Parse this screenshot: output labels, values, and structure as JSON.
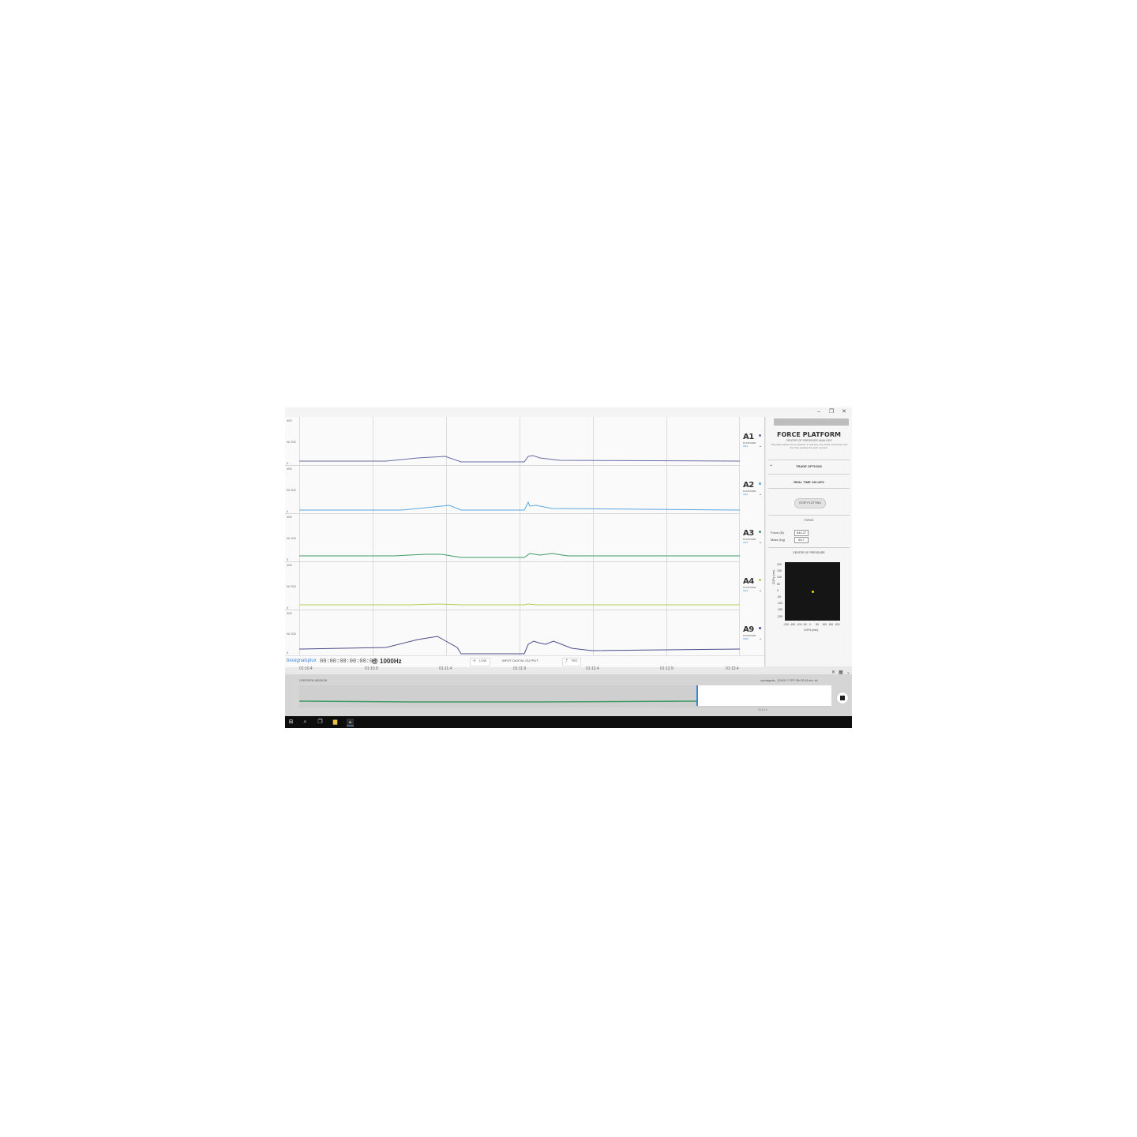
{
  "window": {
    "controls": [
      "–",
      "❐",
      "✕"
    ]
  },
  "channels": [
    {
      "name": "A1",
      "sublabel": "PLATFORM",
      "value": "CH1",
      "color": "#6a6aa8",
      "ylabels": [
        "400",
        "N/ 200",
        "0"
      ]
    },
    {
      "name": "A2",
      "sublabel": "PLATFORM",
      "value": "CH2",
      "color": "#5aa7e0",
      "ylabels": [
        "400",
        "N/ 200",
        "0"
      ]
    },
    {
      "name": "A3",
      "sublabel": "PLATFORM",
      "value": "CH3",
      "color": "#3f9a64",
      "ylabels": [
        "400",
        "N/ 200",
        "0"
      ]
    },
    {
      "name": "A4",
      "sublabel": "PLATFORM",
      "value": "CH4",
      "color": "#b3cf5a",
      "ylabels": [
        "400",
        "N/ 200",
        "0"
      ]
    },
    {
      "name": "A9",
      "sublabel": "PLATFORM",
      "value": "SUM",
      "color": "#4c4c8c",
      "ylabels": [
        "400",
        "N/ 200",
        "0"
      ]
    }
  ],
  "time_axis": [
    "01:10.4",
    "01:10.9",
    "01:11.4",
    "01:11.9",
    "01:12.4",
    "01:12.9",
    "01:13.4"
  ],
  "status": {
    "logo": "biosignalsplux",
    "clock": "00:00:00:00:00:00",
    "rate": "@ 1000Hz",
    "loop_label": "LOW",
    "digital_label": "INPUT   DIGITAL   OUTPUT",
    "trigger_label": "TRG"
  },
  "panel": {
    "title": "FORCE PLATFORM",
    "subtitle": "CENTER OF PRESSURE ANALYSIS",
    "description": "This plugin allows you to observe, in real time, the center of pressure and the force produced in each moment.",
    "trade_options": "TRADE OPTIONS",
    "real_time_values": "REAL TIME VALUES",
    "stop_button": "STOP PLOTTING",
    "force_section": "FORCE",
    "force_label": "Force (N)",
    "force_value": "644.27",
    "mass_label": "Mass (Kg)",
    "mass_value": "65.7",
    "cop_section": "CENTER OF PRESSURE",
    "cop_yaxis": "COPy (mm)",
    "cop_xaxis": "COPx (mm)",
    "cop_yticks": [
      "200",
      "150",
      "100",
      "50",
      "0",
      "-50",
      "-100",
      "-150",
      "-200"
    ],
    "cop_xticks": [
      "-200",
      "-150",
      "-100",
      "-50",
      "0",
      "50",
      "100",
      "150",
      "200"
    ]
  },
  "overview": {
    "label": "OVERVIEW WINDOW",
    "filename": "opensignals_ 201811 7 FPP 00h 00.34 min .txt",
    "cursor_label": "01:13.4"
  },
  "taskbar": {
    "items": [
      "windows-icon",
      "search-icon",
      "taskview-icon",
      "explorer-icon",
      "opensignals-icon"
    ]
  },
  "cop_point": {
    "x": 0,
    "y": 0
  }
}
